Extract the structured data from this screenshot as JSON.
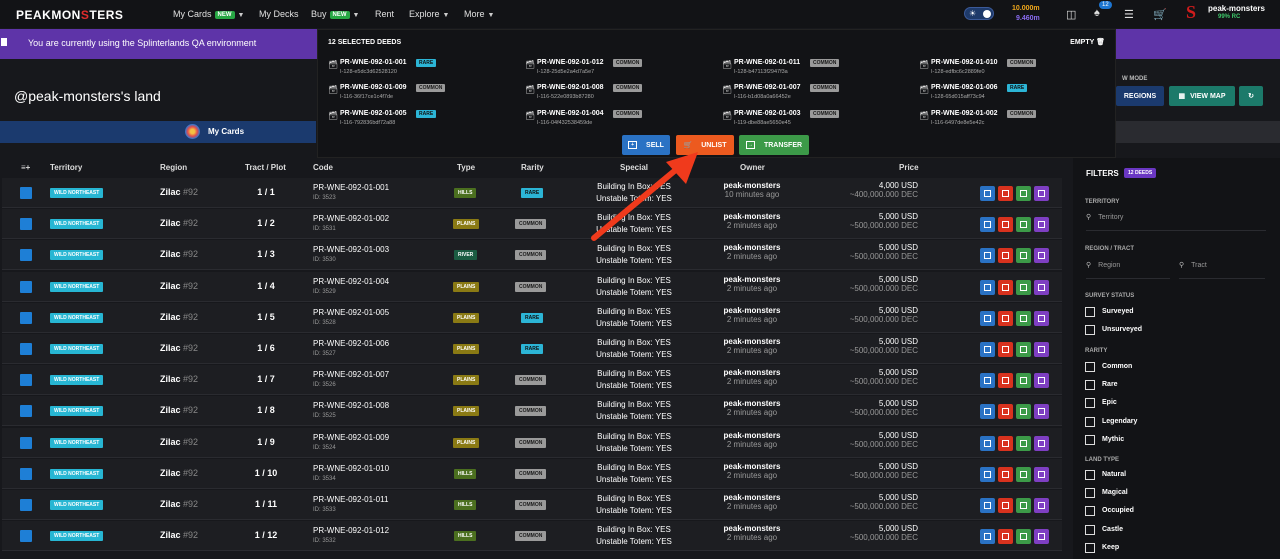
{
  "nav": {
    "logo_a": "PEAKMON",
    "logo_b": "S",
    "logo_c": "TERS",
    "items": [
      "My Cards",
      "My Decks",
      "Buy",
      "Rent",
      "Explore",
      "More"
    ],
    "new_badge": "NEW",
    "bal1": "10.000m",
    "bal2": "9.460m",
    "notif_count": "12",
    "username": "peak-monsters",
    "rc": "99% RC",
    "avatar_letter": "S"
  },
  "banner": {
    "text": "You are currently using the Splinterlands QA environment"
  },
  "land_title": "@peak-monsters's land",
  "my_cards": "My Cards",
  "view_mode": {
    "label": "W MODE",
    "regions": "REGIONS",
    "view_map": "VIEW MAP"
  },
  "popup": {
    "title": "12 SELECTED DEEDS",
    "empty": "EMPTY",
    "deeds": [
      {
        "code": "PR-WNE-092-01-001",
        "rarity": "RARE",
        "sub": "I-128-e5dc3d62528120"
      },
      {
        "code": "PR-WNE-092-01-012",
        "rarity": "COMMON",
        "sub": "I-128-25d5e2a4d7a5e7"
      },
      {
        "code": "PR-WNE-092-01-011",
        "rarity": "COMMON",
        "sub": "I-128-b47113f2947f3a"
      },
      {
        "code": "PR-WNE-092-01-010",
        "rarity": "COMMON",
        "sub": "I-128-edfbc6c2889fe0"
      },
      {
        "code": "PR-WNE-092-01-009",
        "rarity": "COMMON",
        "sub": "I-116-36f17ce1c4f7de"
      },
      {
        "code": "PR-WNE-092-01-008",
        "rarity": "COMMON",
        "sub": "I-116-522e0893b87280"
      },
      {
        "code": "PR-WNE-092-01-007",
        "rarity": "COMMON",
        "sub": "I-116-b1d08a0a66452e"
      },
      {
        "code": "PR-WNE-092-01-006",
        "rarity": "RARE",
        "sub": "I-128-65d015aff73c94"
      },
      {
        "code": "PR-WNE-092-01-005",
        "rarity": "RARE",
        "sub": "I-116-792836bdf72a88"
      },
      {
        "code": "PR-WNE-092-01-004",
        "rarity": "COMMON",
        "sub": "I-116-04f432538459de"
      },
      {
        "code": "PR-WNE-092-01-003",
        "rarity": "COMMON",
        "sub": "I-119-dbe88ae5650e45"
      },
      {
        "code": "PR-WNE-092-01-002",
        "rarity": "COMMON",
        "sub": "I-116-6497de8e5e42c"
      }
    ],
    "sell": "SELL",
    "unlist": "UNLIST",
    "transfer": "TRANSFER"
  },
  "table": {
    "headers": [
      "Territory",
      "Region",
      "Tract / Plot",
      "Code",
      "Type",
      "Rarity",
      "Special",
      "Owner",
      "Price"
    ],
    "rows": [
      {
        "territory": "WILD NORTHEAST",
        "region": "Zilac",
        "tract": "#92",
        "plot": "1 / 1",
        "code": "PR-WNE-092-01-001",
        "id": "ID: 3523",
        "type": "HILLS",
        "rarity": "RARE",
        "sp1": "Building In Box: YES",
        "sp2": "Unstable Totem: YES",
        "owner": "peak-monsters",
        "time": "10 minutes ago",
        "usd": "4,000 USD",
        "dec": "~400,000.000 DEC"
      },
      {
        "territory": "WILD NORTHEAST",
        "region": "Zilac",
        "tract": "#92",
        "plot": "1 / 2",
        "code": "PR-WNE-092-01-002",
        "id": "ID: 3531",
        "type": "PLAINS",
        "rarity": "COMMON",
        "sp1": "Building In Box: YES",
        "sp2": "Unstable Totem: YES",
        "owner": "peak-monsters",
        "time": "2 minutes ago",
        "usd": "5,000 USD",
        "dec": "~500,000.000 DEC"
      },
      {
        "territory": "WILD NORTHEAST",
        "region": "Zilac",
        "tract": "#92",
        "plot": "1 / 3",
        "code": "PR-WNE-092-01-003",
        "id": "ID: 3530",
        "type": "RIVER",
        "rarity": "COMMON",
        "sp1": "Building In Box: YES",
        "sp2": "Unstable Totem: YES",
        "owner": "peak-monsters",
        "time": "2 minutes ago",
        "usd": "5,000 USD",
        "dec": "~500,000.000 DEC"
      },
      {
        "territory": "WILD NORTHEAST",
        "region": "Zilac",
        "tract": "#92",
        "plot": "1 / 4",
        "code": "PR-WNE-092-01-004",
        "id": "ID: 3529",
        "type": "PLAINS",
        "rarity": "COMMON",
        "sp1": "Building In Box: YES",
        "sp2": "Unstable Totem: YES",
        "owner": "peak-monsters",
        "time": "2 minutes ago",
        "usd": "5,000 USD",
        "dec": "~500,000.000 DEC"
      },
      {
        "territory": "WILD NORTHEAST",
        "region": "Zilac",
        "tract": "#92",
        "plot": "1 / 5",
        "code": "PR-WNE-092-01-005",
        "id": "ID: 3528",
        "type": "PLAINS",
        "rarity": "RARE",
        "sp1": "Building In Box: YES",
        "sp2": "Unstable Totem: YES",
        "owner": "peak-monsters",
        "time": "2 minutes ago",
        "usd": "5,000 USD",
        "dec": "~500,000.000 DEC"
      },
      {
        "territory": "WILD NORTHEAST",
        "region": "Zilac",
        "tract": "#92",
        "plot": "1 / 6",
        "code": "PR-WNE-092-01-006",
        "id": "ID: 3527",
        "type": "PLAINS",
        "rarity": "RARE",
        "sp1": "Building In Box: YES",
        "sp2": "Unstable Totem: YES",
        "owner": "peak-monsters",
        "time": "2 minutes ago",
        "usd": "5,000 USD",
        "dec": "~500,000.000 DEC"
      },
      {
        "territory": "WILD NORTHEAST",
        "region": "Zilac",
        "tract": "#92",
        "plot": "1 / 7",
        "code": "PR-WNE-092-01-007",
        "id": "ID: 3526",
        "type": "PLAINS",
        "rarity": "COMMON",
        "sp1": "Building In Box: YES",
        "sp2": "Unstable Totem: YES",
        "owner": "peak-monsters",
        "time": "2 minutes ago",
        "usd": "5,000 USD",
        "dec": "~500,000.000 DEC"
      },
      {
        "territory": "WILD NORTHEAST",
        "region": "Zilac",
        "tract": "#92",
        "plot": "1 / 8",
        "code": "PR-WNE-092-01-008",
        "id": "ID: 3525",
        "type": "PLAINS",
        "rarity": "COMMON",
        "sp1": "Building In Box: YES",
        "sp2": "Unstable Totem: YES",
        "owner": "peak-monsters",
        "time": "2 minutes ago",
        "usd": "5,000 USD",
        "dec": "~500,000.000 DEC"
      },
      {
        "territory": "WILD NORTHEAST",
        "region": "Zilac",
        "tract": "#92",
        "plot": "1 / 9",
        "code": "PR-WNE-092-01-009",
        "id": "ID: 3524",
        "type": "PLAINS",
        "rarity": "COMMON",
        "sp1": "Building In Box: YES",
        "sp2": "Unstable Totem: YES",
        "owner": "peak-monsters",
        "time": "2 minutes ago",
        "usd": "5,000 USD",
        "dec": "~500,000.000 DEC"
      },
      {
        "territory": "WILD NORTHEAST",
        "region": "Zilac",
        "tract": "#92",
        "plot": "1 / 10",
        "code": "PR-WNE-092-01-010",
        "id": "ID: 3534",
        "type": "HILLS",
        "rarity": "COMMON",
        "sp1": "Building In Box: YES",
        "sp2": "Unstable Totem: YES",
        "owner": "peak-monsters",
        "time": "2 minutes ago",
        "usd": "5,000 USD",
        "dec": "~500,000.000 DEC"
      },
      {
        "territory": "WILD NORTHEAST",
        "region": "Zilac",
        "tract": "#92",
        "plot": "1 / 11",
        "code": "PR-WNE-092-01-011",
        "id": "ID: 3533",
        "type": "HILLS",
        "rarity": "COMMON",
        "sp1": "Building In Box: YES",
        "sp2": "Unstable Totem: YES",
        "owner": "peak-monsters",
        "time": "2 minutes ago",
        "usd": "5,000 USD",
        "dec": "~500,000.000 DEC"
      },
      {
        "territory": "WILD NORTHEAST",
        "region": "Zilac",
        "tract": "#92",
        "plot": "1 / 12",
        "code": "PR-WNE-092-01-012",
        "id": "ID: 3532",
        "type": "HILLS",
        "rarity": "COMMON",
        "sp1": "Building In Box: YES",
        "sp2": "Unstable Totem: YES",
        "owner": "peak-monsters",
        "time": "2 minutes ago",
        "usd": "5,000 USD",
        "dec": "~500,000.000 DEC"
      }
    ]
  },
  "filters": {
    "title": "FILTERS",
    "badge": "12 DEEDS",
    "territory_label": "TERRITORY",
    "territory_ph": "Territory",
    "region_label": "REGION / TRACT",
    "region_ph": "Region",
    "tract_ph": "Tract",
    "survey_label": "SURVEY STATUS",
    "survey": [
      "Surveyed",
      "Unsurveyed"
    ],
    "rarity_label": "RARITY",
    "rarity": [
      "Common",
      "Rare",
      "Epic",
      "Legendary",
      "Mythic"
    ],
    "landtype_label": "LAND TYPE",
    "landtype": [
      "Natural",
      "Magical",
      "Occupied",
      "Castle",
      "Keep"
    ]
  }
}
